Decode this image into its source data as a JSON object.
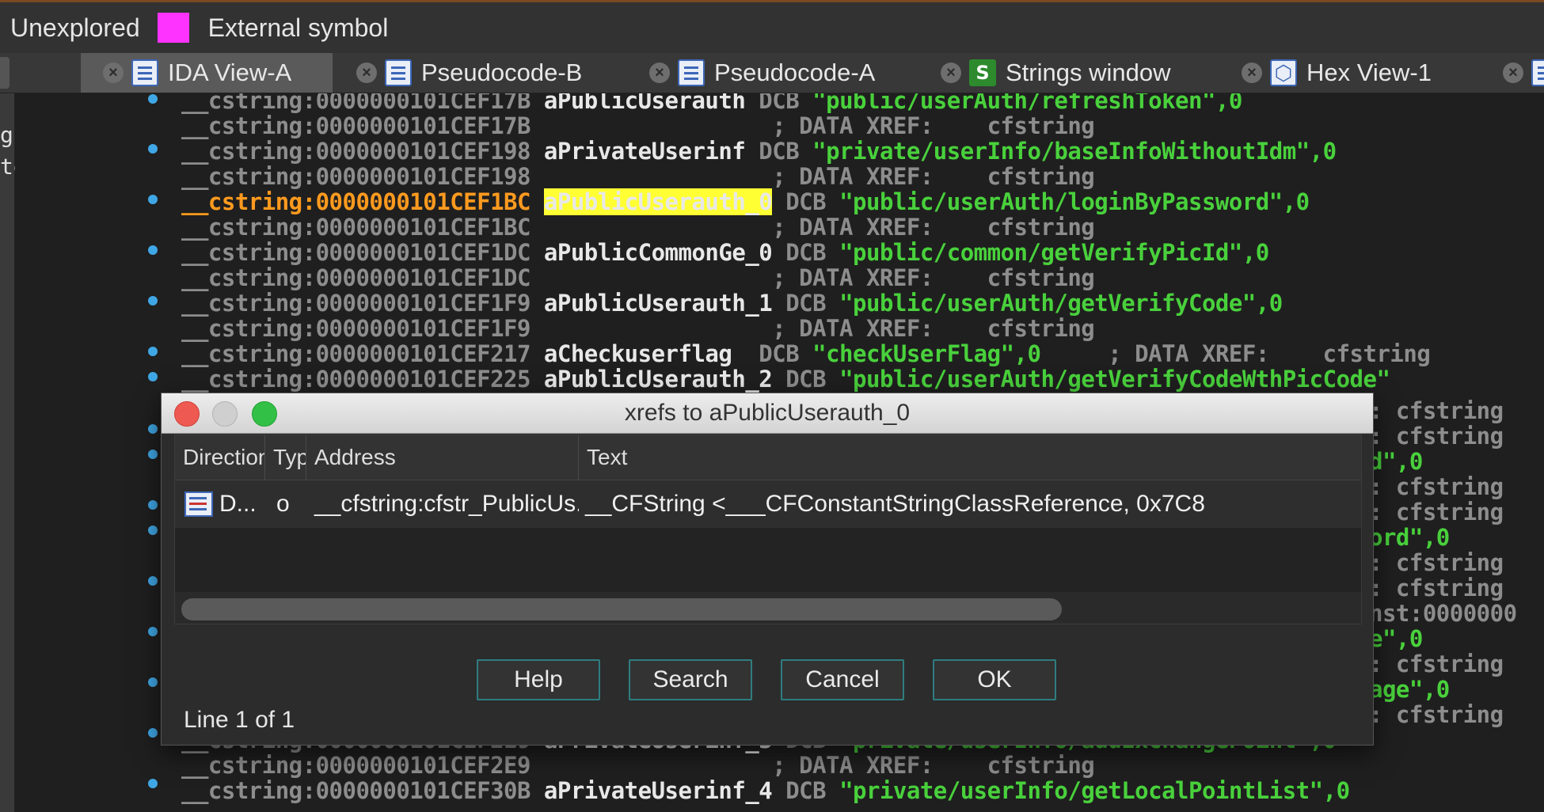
{
  "legend": {
    "unexplored_label": "Unexplored",
    "unexplored_color": "#ff33ff",
    "external_symbol_label": "External symbol"
  },
  "tabs": [
    {
      "label": "IDA View-A",
      "icon": "ida-view-icon",
      "active": true
    },
    {
      "label": "Pseudocode-B",
      "icon": "pseudocode-icon",
      "active": false
    },
    {
      "label": "Pseudocode-A",
      "icon": "pseudocode-icon",
      "active": false
    },
    {
      "label": "Strings window",
      "icon": "strings-icon",
      "active": false
    },
    {
      "label": "Hex View-1",
      "icon": "hex-view-icon",
      "active": false
    }
  ],
  "left_panel": {
    "frag1": "g",
    "frag2": "te"
  },
  "code_lines": [
    {
      "addr": "__cstring:0000000101CEF17B",
      "name": "aPublicUserauth",
      "kw": "DCB",
      "str": "\"public/userAuth/refreshToken\",0"
    },
    {
      "addr": "__cstring:0000000101CEF17B",
      "comment": "; DATA XREF:    cfstring"
    },
    {
      "addr": "__cstring:0000000101CEF198",
      "name": "aPrivateUserinf",
      "kw": "DCB",
      "str": "\"private/userInfo/baseInfoWithoutIdm\",0"
    },
    {
      "addr": "__cstring:0000000101CEF198",
      "comment": "; DATA XREF:    cfstring"
    },
    {
      "addr": "__cstring:0000000101CEF1BC",
      "name": "aPublicUserauth_0",
      "kw": "DCB",
      "str": "\"public/userAuth/loginByPassword\",0"
    },
    {
      "addr": "__cstring:0000000101CEF1BC",
      "comment": "; DATA XREF:    cfstring"
    },
    {
      "addr": "__cstring:0000000101CEF1DC",
      "name": "aPublicCommonGe_0",
      "kw": "DCB",
      "str": "\"public/common/getVerifyPicId\",0"
    },
    {
      "addr": "__cstring:0000000101CEF1DC",
      "comment": "; DATA XREF:    cfstring"
    },
    {
      "addr": "__cstring:0000000101CEF1F9",
      "name": "aPublicUserauth_1",
      "kw": "DCB",
      "str": "\"public/userAuth/getVerifyCode\",0"
    },
    {
      "addr": "__cstring:0000000101CEF1F9",
      "comment": "; DATA XREF:    cfstring"
    },
    {
      "addr": "__cstring:0000000101CEF217",
      "name": "aCheckuserflag",
      "kw": "DCB",
      "str": "\"checkUserFlag\",0",
      "comment": "; DATA XREF:    cfstring"
    },
    {
      "addr": "__cstring:0000000101CEF225",
      "name": "aPublicUserauth_2",
      "kw": "DCB",
      "str": "\"public/userAuth/getVerifyCodeWthPicCode\""
    },
    {
      "addr": "__cstring:0000000101CEF2E9",
      "name": "aPrivateUserinf_3",
      "kw": "DCB",
      "str": "\"private/userInfo/addExchangePoint\",0"
    },
    {
      "addr": "__cstring:0000000101CEF2E9",
      "comment": "; DATA XREF:    cfstring"
    },
    {
      "addr": "__cstring:0000000101CEF30B",
      "name": "aPrivateUserinf_4",
      "kw": "DCB",
      "str": "\"private/userInfo/getLocalPointList\",0"
    }
  ],
  "right_fragments": [
    ": cfstring",
    ": cfstring",
    "d\",0",
    ": cfstring",
    ": cfstring",
    "ord\",0",
    ": cfstring",
    ": cfstring",
    "nst:0000000",
    "e\",0",
    ": cfstring",
    "age\",0",
    ": cfstring"
  ],
  "dialog": {
    "title": "xrefs to aPublicUserauth_0",
    "columns": [
      "Direction",
      "Typ",
      "Address",
      "Text"
    ],
    "rows": [
      {
        "direction": "D...",
        "type": "o",
        "address": "__cfstring:cfstr_PublicUs...",
        "text": "__CFString <___CFConstantStringClassReference, 0x7C8"
      }
    ],
    "buttons": {
      "help": "Help",
      "search": "Search",
      "cancel": "Cancel",
      "ok": "OK"
    },
    "status": "Line 1 of 1"
  }
}
